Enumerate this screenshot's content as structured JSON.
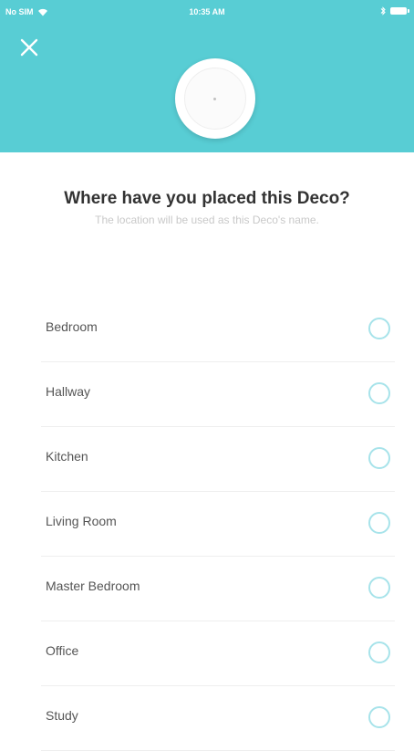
{
  "status_bar": {
    "carrier": "No SIM",
    "time": "10:35 AM",
    "wifi_icon": "wifi-icon",
    "bluetooth_icon": "bluetooth-icon",
    "battery_icon": "battery-icon"
  },
  "header": {
    "background": "#58cdd4",
    "close_icon": "close-icon",
    "device_image": "deco-device-icon"
  },
  "prompt": {
    "title": "Where have you placed this Deco?",
    "subtitle": "The location will be used as this Deco's name."
  },
  "locations": [
    {
      "label": "Bedroom",
      "selected": false
    },
    {
      "label": "Hallway",
      "selected": false
    },
    {
      "label": "Kitchen",
      "selected": false
    },
    {
      "label": "Living Room",
      "selected": false
    },
    {
      "label": "Master Bedroom",
      "selected": false
    },
    {
      "label": "Office",
      "selected": false
    },
    {
      "label": "Study",
      "selected": false
    }
  ],
  "colors": {
    "accent": "#58cdd4",
    "radio_border": "#a7e3ea",
    "title_text": "#333333",
    "subtitle_text": "#c9c9c9"
  }
}
